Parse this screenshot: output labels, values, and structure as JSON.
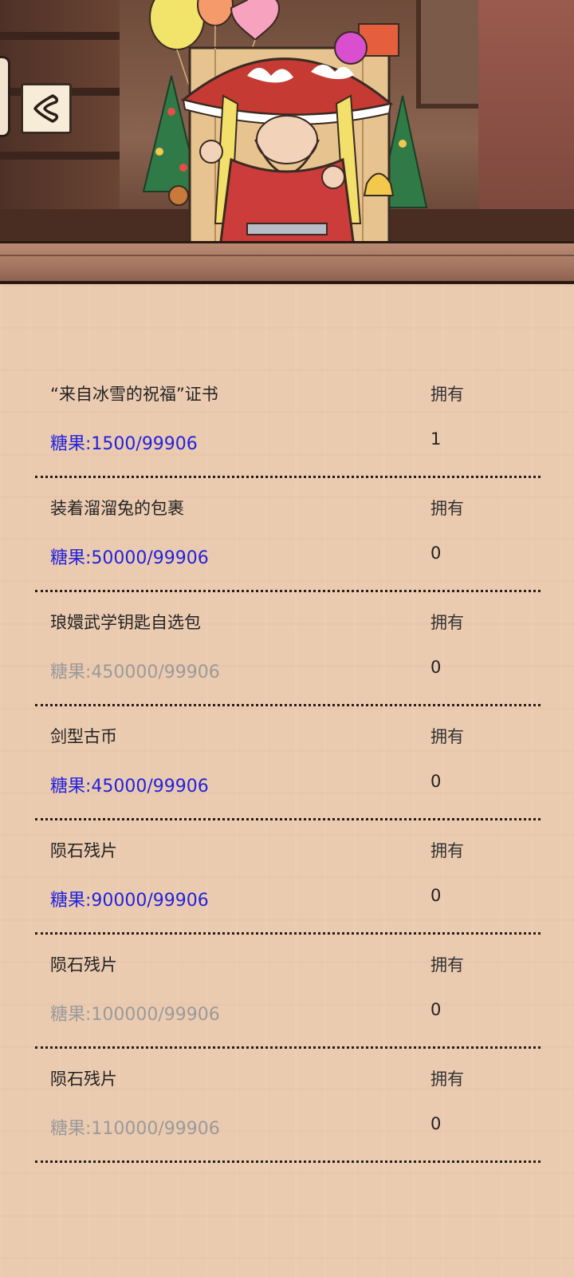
{
  "header": {
    "back_icon": "chevron-left-icon"
  },
  "exchange": {
    "own_label": "拥有",
    "items": [
      {
        "name": "“来自冰雪的祝福”证书",
        "cost": "糖果:1500/99906",
        "owned": "1",
        "affordable": true
      },
      {
        "name": "装着溜溜兔的包裹",
        "cost": "糖果:50000/99906",
        "owned": "0",
        "affordable": true
      },
      {
        "name": "琅嬛武学钥匙自选包",
        "cost": "糖果:450000/99906",
        "owned": "0",
        "affordable": false
      },
      {
        "name": "剑型古币",
        "cost": "糖果:45000/99906",
        "owned": "0",
        "affordable": true
      },
      {
        "name": "陨石残片",
        "cost": "糖果:90000/99906",
        "owned": "0",
        "affordable": true
      },
      {
        "name": "陨石残片",
        "cost": "糖果:100000/99906",
        "owned": "0",
        "affordable": false
      },
      {
        "name": "陨石残片",
        "cost": "糖果:110000/99906",
        "owned": "0",
        "affordable": false
      }
    ]
  },
  "colors": {
    "affordable": "#2222dd",
    "insufficient": "#9a9a9a",
    "panel": "#ebcbb0"
  }
}
